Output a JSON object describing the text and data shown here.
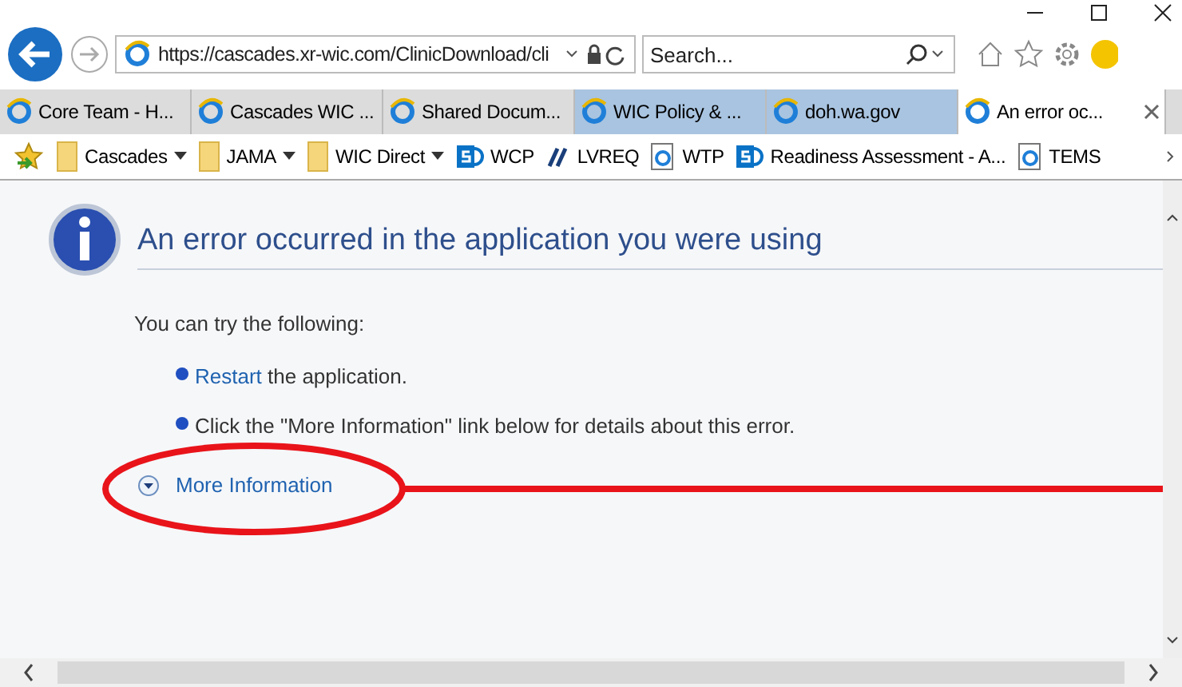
{
  "address": {
    "url": "https://cascades.xr-wic.com/ClinicDownload/cli",
    "search_placeholder": "Search..."
  },
  "tabs": [
    {
      "label": "Core Team - H...",
      "selected": false,
      "highlighted": false
    },
    {
      "label": "Cascades WIC ...",
      "selected": false,
      "highlighted": false
    },
    {
      "label": "Shared Docum...",
      "selected": false,
      "highlighted": false
    },
    {
      "label": "WIC Policy & ...",
      "selected": false,
      "highlighted": true
    },
    {
      "label": "doh.wa.gov",
      "selected": false,
      "highlighted": true
    },
    {
      "label": "An error oc...",
      "selected": true,
      "highlighted": false
    }
  ],
  "favorites": [
    {
      "label": "Cascades",
      "kind": "folder"
    },
    {
      "label": "JAMA",
      "kind": "folder"
    },
    {
      "label": "WIC Direct",
      "kind": "folder"
    },
    {
      "label": "WCP",
      "kind": "sharepoint"
    },
    {
      "label": "LVREQ",
      "kind": "site"
    },
    {
      "label": "WTP",
      "kind": "page"
    },
    {
      "label": "Readiness Assessment - A...",
      "kind": "sharepoint"
    },
    {
      "label": "TEMS",
      "kind": "page"
    }
  ],
  "error": {
    "title": "An error occurred in the application you were using",
    "intro": "You can try the following:",
    "suggestions": [
      {
        "link": "Restart",
        "text": " the application."
      },
      {
        "text": "Click the \"More Information\" link below for details about this error."
      }
    ],
    "more_link": "More Information",
    "expanded": false
  }
}
